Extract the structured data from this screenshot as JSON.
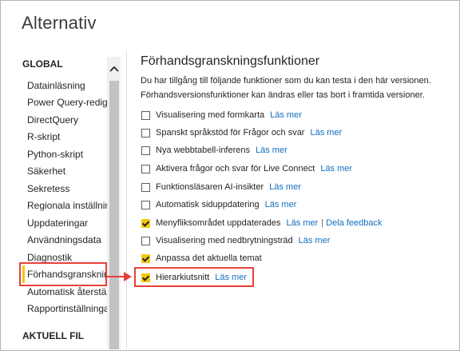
{
  "window": {
    "title": "Alternativ"
  },
  "sidebar": {
    "global_heading": "GLOBAL",
    "current_file_heading": "AKTUELL FIL",
    "items": [
      {
        "label": "Datainläsning"
      },
      {
        "label": "Power Query-redigeraren"
      },
      {
        "label": "DirectQuery"
      },
      {
        "label": "R-skript"
      },
      {
        "label": "Python-skript"
      },
      {
        "label": "Säkerhet"
      },
      {
        "label": "Sekretess"
      },
      {
        "label": "Regionala inställningar"
      },
      {
        "label": "Uppdateringar"
      },
      {
        "label": "Användningsdata"
      },
      {
        "label": "Diagnostik"
      },
      {
        "label": "Förhandsgranskningsfunktioner",
        "active": true
      },
      {
        "label": "Automatisk återställning"
      },
      {
        "label": "Rapportinställningar"
      }
    ]
  },
  "main": {
    "heading": "Förhandsgranskningsfunktioner",
    "description_line1": "Du har tillgång till följande funktioner som du kan testa i den här versionen.",
    "description_line2": "Förhandsversionsfunktioner kan ändras eller tas bort i framtida versioner.",
    "learn_more": "Läs mer",
    "feedback": "Dela feedback",
    "separator": "|",
    "options": [
      {
        "label": "Visualisering med formkarta",
        "checked": false
      },
      {
        "label": "Spanskt språkstöd för Frågor och svar",
        "checked": false
      },
      {
        "label": "Nya webbtabell-inferens",
        "checked": false
      },
      {
        "label": "Aktivera frågor och svar för Live Connect",
        "checked": false
      },
      {
        "label": "Funktionsläsaren AI-insikter",
        "checked": false
      },
      {
        "label": "Automatisk siduppdatering",
        "checked": false
      },
      {
        "label": "Menyfliksområdet uppdaterades",
        "checked": true
      },
      {
        "label": "Visualisering med nedbrytningsträd",
        "checked": false
      },
      {
        "label": "Anpassa det aktuella temat",
        "checked": true
      },
      {
        "label": "Hierarkiutsnitt",
        "checked": true
      }
    ]
  },
  "colors": {
    "accent": "#f2c811",
    "link": "#106ebe",
    "highlight": "#e8413b"
  }
}
